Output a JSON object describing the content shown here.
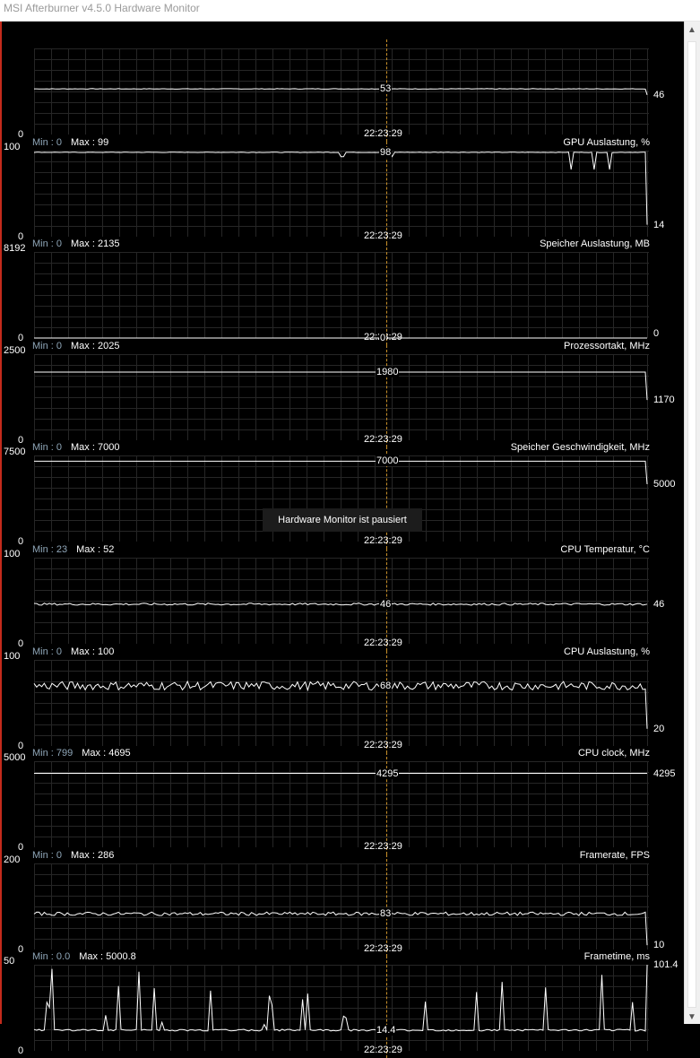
{
  "window": {
    "title": "MSI Afterburner v4.5.0 Hardware Monitor"
  },
  "overlay": {
    "paused_text": "Hardware Monitor ist pausiert"
  },
  "colors": {
    "background": "#000000",
    "grid": "#262626",
    "line": "#ffffff",
    "cursor": "#c8902a",
    "min_text": "#8fa6b8"
  },
  "panels": [
    {
      "id": "p0",
      "name": "",
      "min_label": "",
      "max_label": "",
      "ymax": "",
      "ymin": "0",
      "time": "22:23:29",
      "current": "53",
      "right": "46",
      "range": [
        0,
        100
      ],
      "pattern": "flat",
      "base": 53,
      "noise": 0.6,
      "end": 46
    },
    {
      "id": "p1",
      "name": "GPU Auslastung, %",
      "min_label": "Min : 0",
      "max_label": "Max : 99",
      "ymax": "100",
      "ymin": "0",
      "time": "22:23:29",
      "current": "98",
      "right": "14",
      "range": [
        0,
        100
      ],
      "pattern": "gpu",
      "base": 98,
      "noise": 0.5,
      "end": 14
    },
    {
      "id": "p2",
      "name": "Speicher Auslastung, MB",
      "min_label": "Min : 0",
      "max_label": "Max : 2135",
      "ymax": "8192",
      "ymin": "0",
      "time": "22:23:29",
      "current": "0",
      "right": "0",
      "range": [
        0,
        8192
      ],
      "pattern": "flat",
      "base": 0,
      "noise": 0,
      "end": 0
    },
    {
      "id": "p3",
      "name": "Prozessortakt, MHz",
      "min_label": "Min : 0",
      "max_label": "Max : 2025",
      "ymax": "2500",
      "ymin": "0",
      "time": "22:23:29",
      "current": "1980",
      "right": "1170",
      "range": [
        0,
        2500
      ],
      "pattern": "flat",
      "base": 1980,
      "noise": 0,
      "end": 1170
    },
    {
      "id": "p4",
      "name": "Speicher Geschwindigkeit, MHz",
      "min_label": "Min : 0",
      "max_label": "Max : 7000",
      "ymax": "7500",
      "ymin": "0",
      "time": "22:23:29",
      "current": "7000",
      "right": "5000",
      "range": [
        0,
        7500
      ],
      "pattern": "flat",
      "base": 7000,
      "noise": 0,
      "end": 5000
    },
    {
      "id": "p5",
      "name": "CPU Temperatur, °C",
      "min_label": "Min : 23",
      "max_label": "Max : 52",
      "ymax": "100",
      "ymin": "0",
      "time": "22:23:29",
      "current": "46",
      "right": "46",
      "range": [
        0,
        100
      ],
      "pattern": "noisy",
      "base": 46,
      "noise": 1.2,
      "end": 46
    },
    {
      "id": "p6",
      "name": "CPU Auslastung, %",
      "min_label": "Min : 0",
      "max_label": "Max : 100",
      "ymax": "100",
      "ymin": "0",
      "time": "22:23:29",
      "current": "68",
      "right": "20",
      "range": [
        0,
        100
      ],
      "pattern": "noisy",
      "base": 70,
      "noise": 5,
      "end": 20
    },
    {
      "id": "p7",
      "name": "CPU clock, MHz",
      "min_label": "Min : 799",
      "max_label": "Max : 4695",
      "ymax": "5000",
      "ymin": "0",
      "time": "22:23:29",
      "current": "4295",
      "right": "4295",
      "range": [
        0,
        5000
      ],
      "pattern": "flat",
      "base": 4295,
      "noise": 0,
      "end": 4295
    },
    {
      "id": "p8",
      "name": "Framerate, FPS",
      "min_label": "Min : 0",
      "max_label": "Max : 286",
      "ymax": "200",
      "ymin": "0",
      "time": "22:23:29",
      "current": "83",
      "right": "10",
      "range": [
        0,
        200
      ],
      "pattern": "noisy",
      "base": 83,
      "noise": 4,
      "end": 10
    },
    {
      "id": "p9",
      "name": "Frametime, ms",
      "min_label": "Min : 0.0",
      "max_label": "Max : 5000.8",
      "ymax": "50",
      "ymin": "0",
      "time": "22:23:29",
      "current": "14.4",
      "right": "101.4",
      "range": [
        0,
        50
      ],
      "pattern": "spiky",
      "base": 12,
      "noise": 1,
      "end": 50
    }
  ]
}
